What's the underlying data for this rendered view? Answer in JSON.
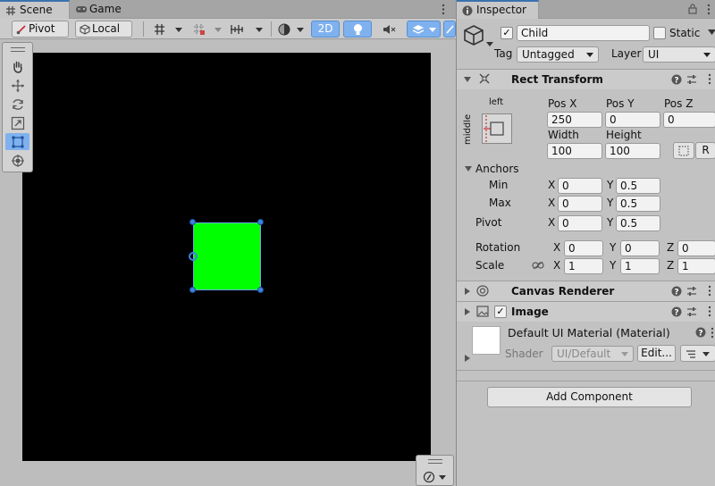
{
  "tabs": {
    "scene_label": "Scene",
    "game_label": "Game",
    "inspector_label": "Inspector"
  },
  "toolbar": {
    "pivot_label": "Pivot",
    "local_label": "Local",
    "mode_2d_label": "2D"
  },
  "inspector": {
    "object_name": "Child",
    "active_checked": true,
    "static_label": "Static",
    "static_checked": false,
    "tag_label": "Tag",
    "tag_value": "Untagged",
    "layer_label": "Layer",
    "layer_value": "UI"
  },
  "rect_transform": {
    "title": "Rect Transform",
    "anchor_h_label": "left",
    "anchor_v_label": "middle",
    "pos_x_label": "Pos X",
    "pos_y_label": "Pos Y",
    "pos_z_label": "Pos Z",
    "pos_x": "250",
    "pos_y": "0",
    "pos_z": "0",
    "width_label": "Width",
    "height_label": "Height",
    "width": "100",
    "height": "100",
    "r_button_label": "R",
    "anchors_label": "Anchors",
    "min_label": "Min",
    "max_label": "Max",
    "pivot_label": "Pivot",
    "x_label": "X",
    "y_label": "Y",
    "z_label": "Z",
    "anchor_min_x": "0",
    "anchor_min_y": "0.5",
    "anchor_max_x": "0",
    "anchor_max_y": "0.5",
    "pivot_x": "0",
    "pivot_y": "0.5",
    "rotation_label": "Rotation",
    "rotation_x": "0",
    "rotation_y": "0",
    "rotation_z": "0",
    "scale_label": "Scale",
    "scale_x": "1",
    "scale_y": "1",
    "scale_z": "1"
  },
  "canvas_renderer": {
    "title": "Canvas Renderer"
  },
  "image": {
    "title": "Image",
    "enabled": true,
    "material_name": "Default UI Material (Material)",
    "shader_label": "Shader",
    "shader_value": "UI/Default",
    "edit_label": "Edit..."
  },
  "add_component_label": "Add Component",
  "colors": {
    "sprite": "#00ff00",
    "canvas_bg": "#000000",
    "accent": "#3b83e0"
  },
  "icons": {
    "scene_tab": "grid-icon",
    "game_tab": "gamepad-icon",
    "inspector_tab": "info-icon",
    "lock": "lock-icon",
    "menu": "kebab-icon",
    "hand_tool": "hand-icon",
    "move_tool": "move-icon",
    "rotate_tool": "rotate-icon",
    "scale_tool": "scale-icon",
    "rect_tool": "rect-icon",
    "transform_tool": "transform-icon"
  }
}
